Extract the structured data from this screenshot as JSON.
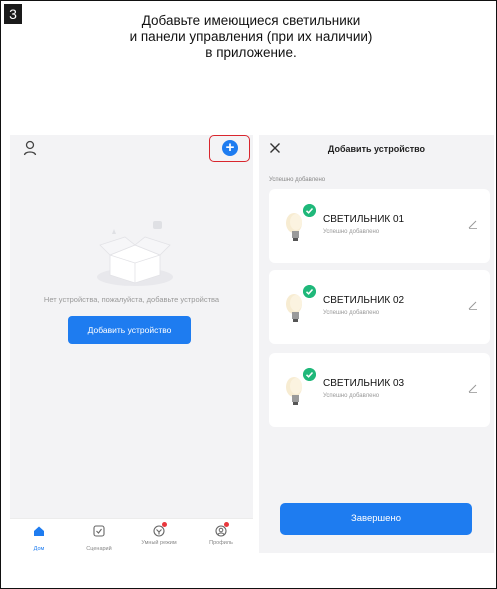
{
  "step": {
    "number": "3",
    "lines": [
      "Добавьте имеющиеся светильники",
      "и панели управления (при их наличии)",
      "в приложение."
    ]
  },
  "left": {
    "empty_text": "Нет устройства, пожалуйста, добавьте устройства",
    "add_button": "Добавить устройство",
    "tabs": [
      {
        "label": "Дом",
        "icon": "home-icon"
      },
      {
        "label": "Сценарий",
        "icon": "scenario-icon"
      },
      {
        "label": "Умный режим",
        "icon": "smart-mode-icon"
      },
      {
        "label": "Профиль",
        "icon": "profile-icon"
      }
    ]
  },
  "right": {
    "title": "Добавить устройство",
    "subtitle": "Успешно добавлено",
    "devices": [
      {
        "name": "СВЕТИЛЬНИК 01",
        "status": "Успешно добавлено"
      },
      {
        "name": "СВЕТИЛЬНИК 02",
        "status": "Успешно добавлено"
      },
      {
        "name": "СВЕТИЛЬНИК 03",
        "status": "Успешно добавлено"
      }
    ],
    "done_button": "Завершено"
  },
  "colors": {
    "accent": "#1e7cf0",
    "success": "#1fb87a",
    "highlight": "#d9262e",
    "badge": "#e8383d"
  }
}
